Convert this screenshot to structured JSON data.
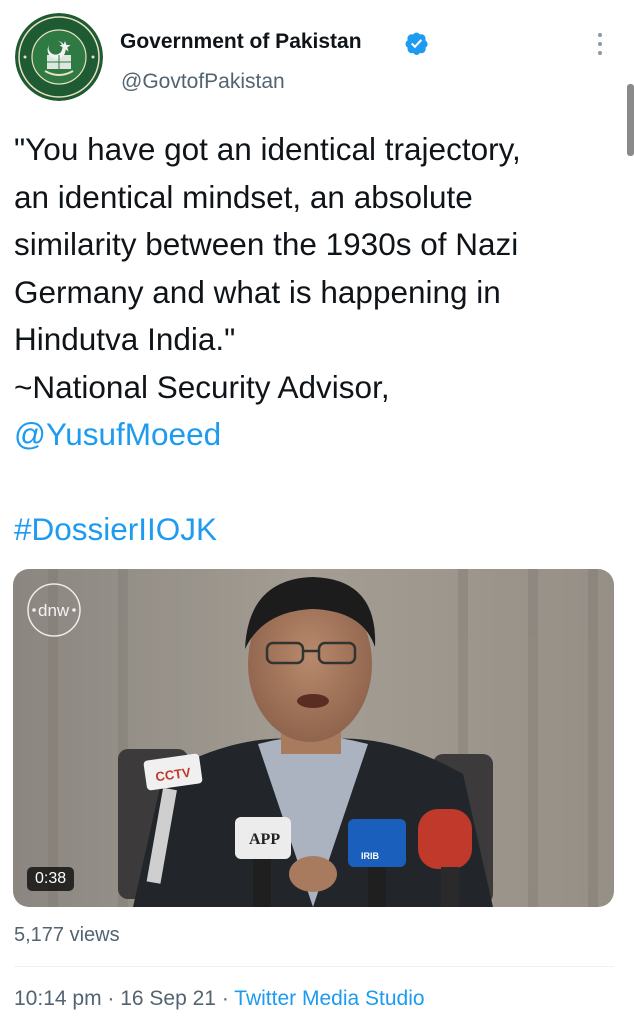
{
  "account": {
    "display_name": "Government of Pakistan",
    "handle": "@GovtofPakistan",
    "avatar_icon": "government-seal-icon",
    "verified_icon": "verified-badge-icon",
    "verified_color": "#1d9bf0"
  },
  "tweet": {
    "lines": [
      "\"You have got an identical trajectory,",
      "an identical mindset, an absolute",
      "similarity between the 1930s of Nazi",
      "Germany and what is happening in",
      "Hindutva India.\"",
      "~National Security Advisor,"
    ],
    "mention": "@YusufMoeed",
    "hashtag": "#DossierIIOJK"
  },
  "media": {
    "type": "video",
    "duration": "0:38",
    "mic_labels": [
      "CCTV",
      "APP",
      "IRIB"
    ]
  },
  "stats": {
    "views": "5,177 views"
  },
  "meta": {
    "time": "10:14 pm",
    "sep1": " · ",
    "date": "16 Sep 21",
    "sep2": " · ",
    "source": "Twitter Media Studio"
  },
  "colors": {
    "link": "#1d9bf0",
    "secondary_text": "#536471",
    "primary_text": "#0f1419"
  }
}
